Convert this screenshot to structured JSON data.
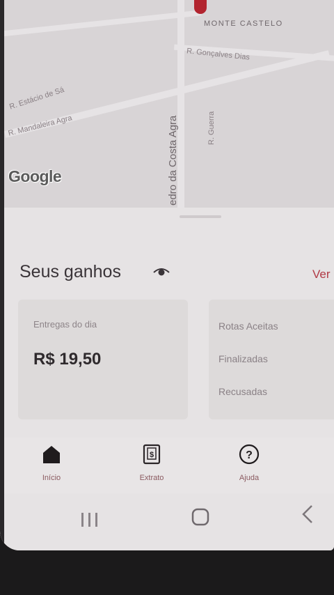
{
  "map": {
    "labels": {
      "neighborhood": "MONTE CASTELO",
      "street_goncalves": "R. Gonçalves Dias",
      "street_estacio": "R. Estácio de Sá",
      "street_mandaleira": "R. Mandaleira Agra",
      "street_costa_agra": "edro da Costa Agra",
      "street_small": "R. Guerra"
    },
    "logo_text": "Google"
  },
  "earnings": {
    "title": "Seus ganhos",
    "see_link": "Ver",
    "deliveries_label": "Entregas do dia",
    "deliveries_value": "R$ 19,50",
    "stats": [
      "Rotas Aceitas",
      "Finalizadas",
      "Recusadas"
    ]
  },
  "bottom_nav": {
    "items": [
      {
        "label": "Início",
        "icon": "home-icon"
      },
      {
        "label": "Extrato",
        "icon": "statement-icon"
      },
      {
        "label": "Ajuda",
        "icon": "help-icon"
      }
    ]
  },
  "colors": {
    "accent": "#b13a45",
    "map_pin": "#b2242f"
  }
}
